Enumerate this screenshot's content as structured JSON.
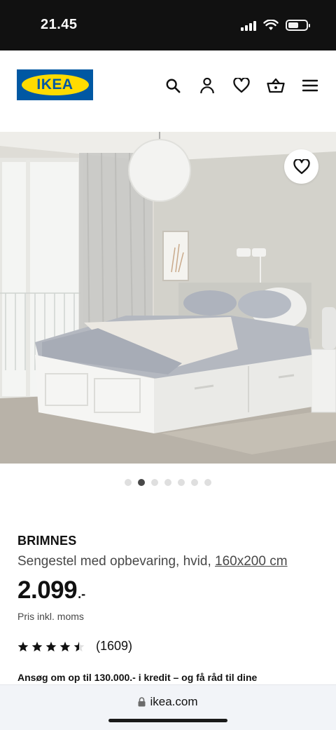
{
  "status": {
    "time": "21.45"
  },
  "header": {
    "logo_text": "IKEA",
    "icons": [
      "search-icon",
      "account-icon",
      "heart-icon",
      "basket-icon",
      "menu-icon"
    ]
  },
  "hero": {
    "image": "bed-in-bedroom-photo",
    "favourite_icon": "heart-icon",
    "carousel": {
      "total": 7,
      "active": 2
    }
  },
  "product": {
    "name": "BRIMNES",
    "description": "Sengestel med opbevaring, hvid, ",
    "size": "160x200 cm",
    "price_main": "2.099",
    "price_tail": ".-",
    "price_note": "Pris inkl. moms",
    "rating": 4.5,
    "rating_max": 5,
    "rating_count": "(1609)",
    "promo": "Ansøg om op til 130.000.- i kredit – og få råd til dine"
  },
  "browser": {
    "url": "ikea.com",
    "lock_icon": "lock-icon"
  },
  "colors": {
    "ikea_blue": "#0058a3",
    "ikea_yellow": "#ffdb00"
  }
}
